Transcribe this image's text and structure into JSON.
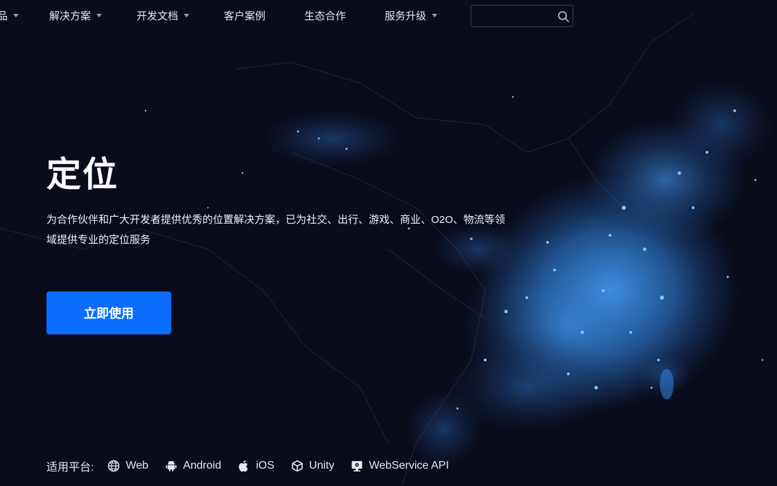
{
  "nav": {
    "items": [
      {
        "label": "品",
        "has_caret": true
      },
      {
        "label": "解决方案",
        "has_caret": true
      },
      {
        "label": "开发文档",
        "has_caret": true
      },
      {
        "label": "客户案例",
        "has_caret": false
      },
      {
        "label": "生态合作",
        "has_caret": false
      },
      {
        "label": "服务升级",
        "has_caret": true
      }
    ],
    "search": {
      "placeholder": "",
      "value": "",
      "icon": "search-icon"
    }
  },
  "hero": {
    "title": "定位",
    "description": "为合作伙伴和广大开发者提供优秀的位置解决方案，已为社交、出行、游戏、商业、O2O、物流等领域提供专业的定位服务",
    "cta_label": "立即使用"
  },
  "platforms": {
    "label": "适用平台:",
    "items": [
      {
        "name": "Web",
        "icon": "globe-icon"
      },
      {
        "name": "Android",
        "icon": "android-icon"
      },
      {
        "name": "iOS",
        "icon": "apple-icon"
      },
      {
        "name": "Unity",
        "icon": "unity-icon"
      },
      {
        "name": "WebService API",
        "icon": "webservice-icon"
      }
    ]
  },
  "colors": {
    "background": "#0a0b1b",
    "accent": "#0b6dff",
    "map_glow": "#3a8ee6"
  }
}
